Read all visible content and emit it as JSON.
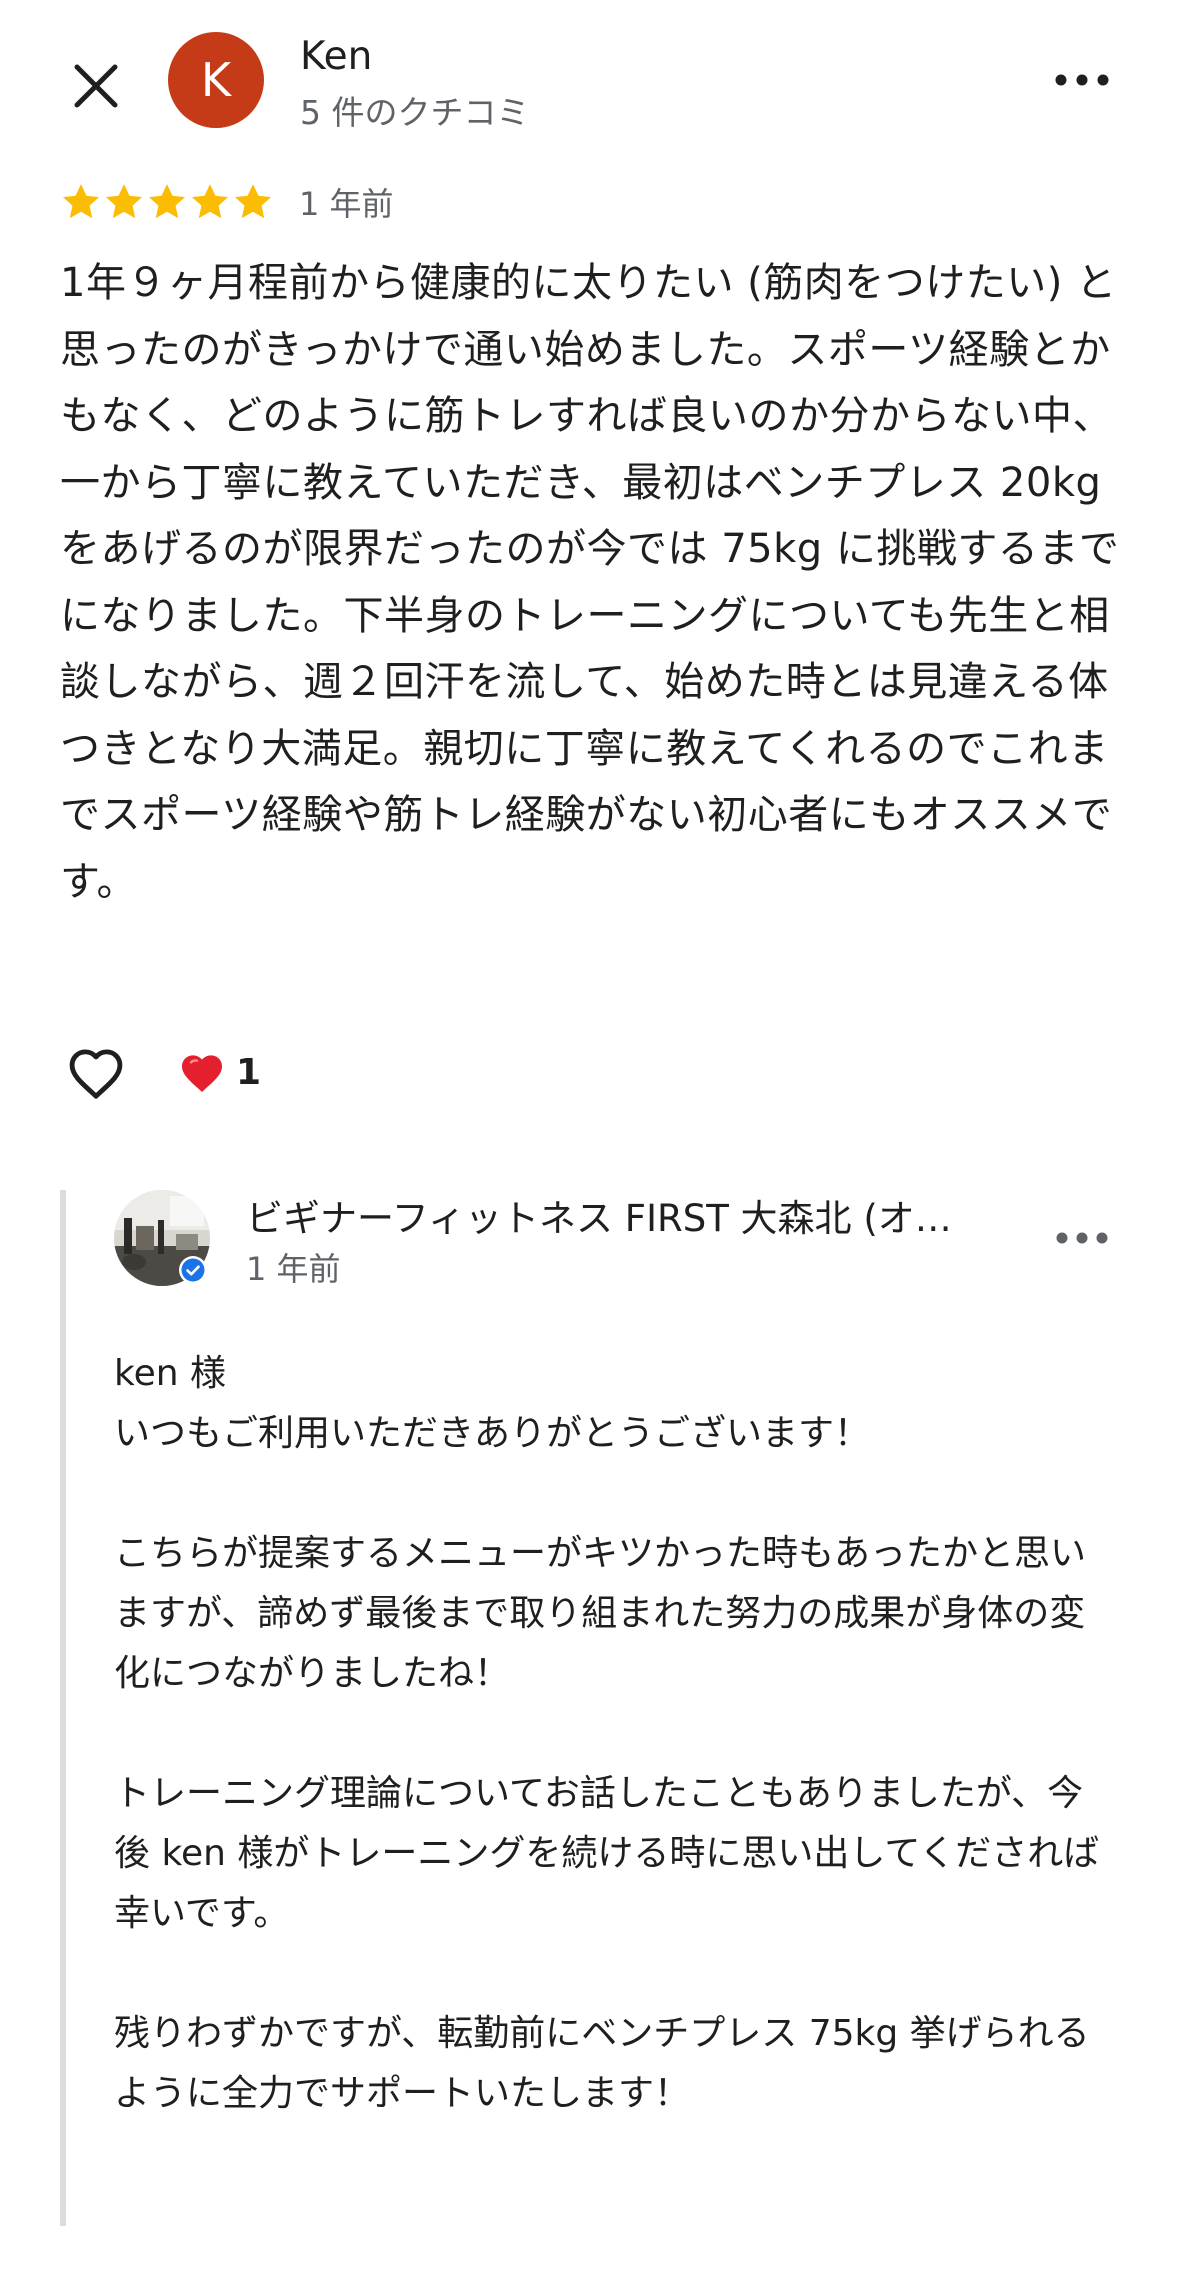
{
  "header": {
    "avatar_letter": "K",
    "avatar_color": "#c53a17",
    "name": "Ken",
    "review_count": "5 件のクチコミ",
    "close_icon": "close-icon",
    "more_icon": "more-horiz-icon"
  },
  "review": {
    "rating": 5,
    "star_color": "#fbbc04",
    "date": "1 年前",
    "text": "1年９ヶ月程前から健康的に太りたい (筋肉をつけたい) と思ったのがきっかけで通い始めました。スポーツ経験とかもなく、どのように筋トレすれば良いのか分からない中、一から丁寧に教えていただき、最初はベンチプレス 20kg をあげるのが限界だったのが今では 75kg に挑戦するまでになりました。下半身のトレーニングについても先生と相談しながら、週２回汗を流して、始めた時とは見違える体つきとなり大満足。親切に丁寧に教えてくれるのでこれまでスポーツ経験や筋トレ経験がない初心者にもオススメです。",
    "reaction_count": "1"
  },
  "owner_reply": {
    "name": "ビギナーフィットネス FIRST 大森北 (オ…",
    "date": "1 年前",
    "text": "ken 様\nいつもご利用いただきありがとうございます！\n\nこちらが提案するメニューがキツかった時もあったかと思いますが、諦めず最後まで取り組まれた努力の成果が身体の変化につながりましたね！\n\nトレーニング理論についてお話したこともありましたが、今後 ken 様がトレーニングを続ける時に思い出してくだされば幸いです。\n\n残りわずかですが、転勤前にベンチプレス 75kg 挙げられるように全力でサポートいたします！"
  }
}
